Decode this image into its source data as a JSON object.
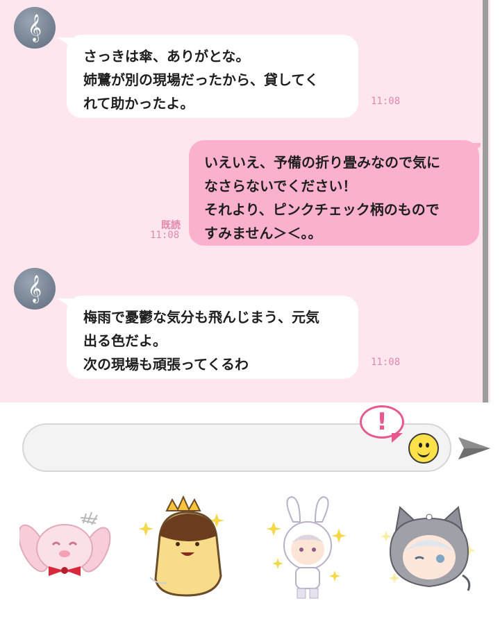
{
  "chat": {
    "messages": [
      {
        "direction": "incoming",
        "avatar_icon": "treble-clef",
        "avatar_glyph": "𝄞",
        "lines": [
          "さっきは傘、ありがとな。",
          "姉鷺が別の現場だったから、貸してく",
          "れて助かったよ。"
        ],
        "time": "11:08"
      },
      {
        "direction": "outgoing",
        "read_label": "既読",
        "lines": [
          "いえいえ、予備の折り畳みなので気に",
          "なさらないでください！",
          "それより、ピンクチェック柄のもので",
          "すみません＞＜。。"
        ],
        "time": "11:08"
      },
      {
        "direction": "incoming",
        "avatar_icon": "treble-clef",
        "avatar_glyph": "𝄞",
        "lines": [
          "梅雨で憂鬱な気分も飛んじまう、元気",
          "出る色だよ。",
          "次の現場も頑張ってくるわ"
        ],
        "time": "11:08"
      }
    ]
  },
  "composer": {
    "input_value": "",
    "alert_glyph": "!",
    "emoji_icon": "smiley-face-icon",
    "send_icon": "send-arrow-icon"
  },
  "sticker_tray": {
    "stickers": [
      {
        "icon": "pink-bunny-sticker"
      },
      {
        "icon": "crowned-pudding-sticker"
      },
      {
        "icon": "bunny-hood-character-sticker"
      },
      {
        "icon": "cat-hood-character-sticker"
      }
    ]
  },
  "colors": {
    "chat_background": "#fde6ee",
    "incoming_bubble": "#ffffff",
    "outgoing_bubble": "#fbb1cd",
    "timestamp": "#e487ab",
    "accent": "#e6588f"
  }
}
